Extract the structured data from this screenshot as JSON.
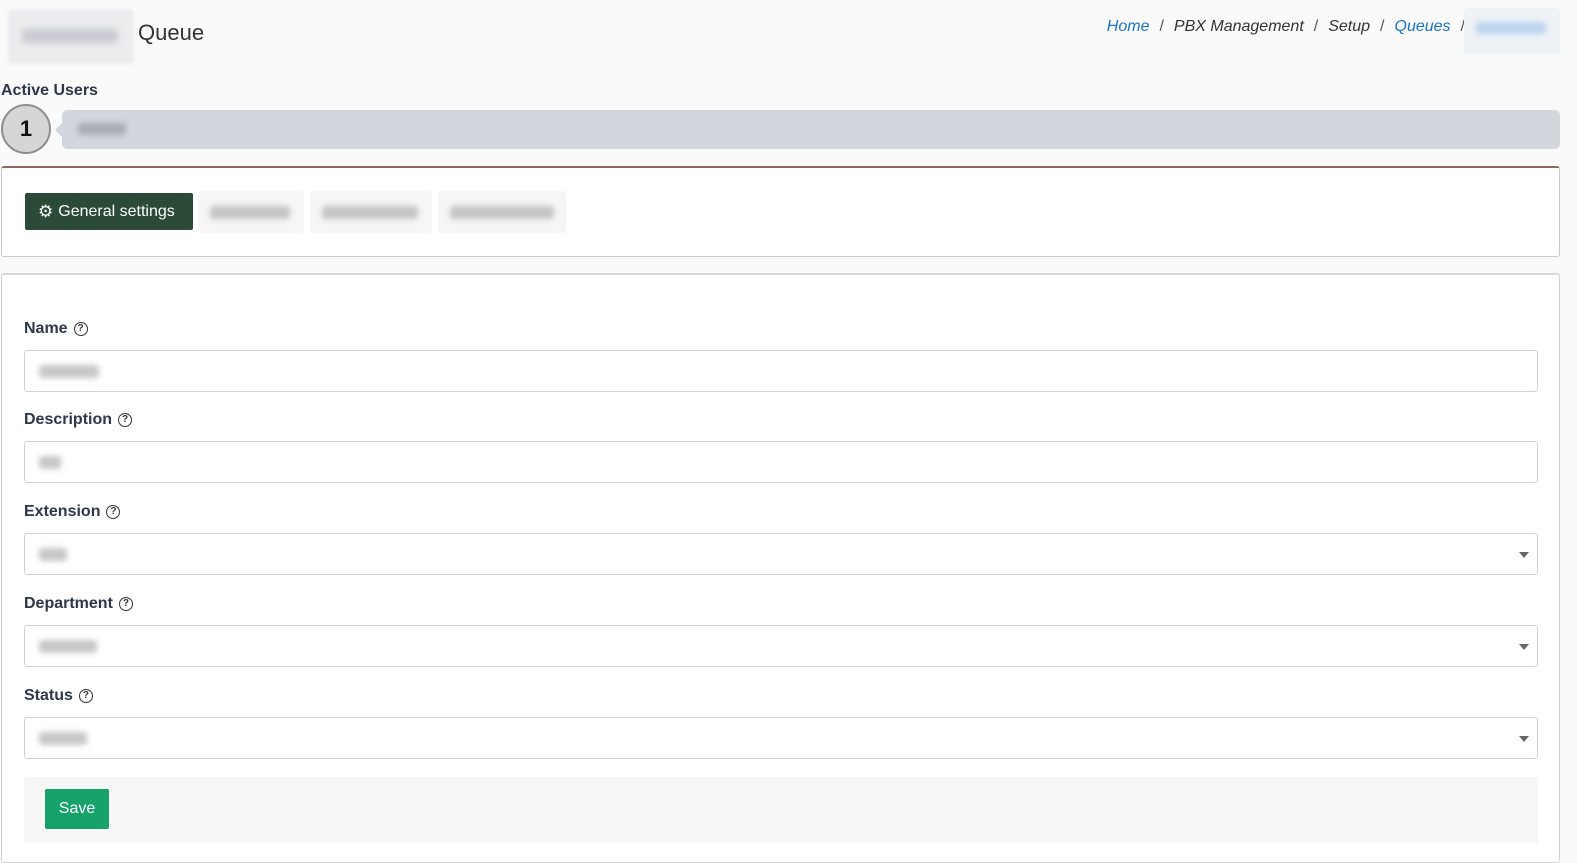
{
  "header": {
    "title": "Queue"
  },
  "breadcrumb": {
    "items": [
      {
        "label": "Home",
        "link": true
      },
      {
        "label": "PBX Management",
        "link": false
      },
      {
        "label": "Setup",
        "link": false
      },
      {
        "label": "Queues",
        "link": true
      }
    ],
    "separator": "/"
  },
  "active_users": {
    "label": "Active Users",
    "count": "1"
  },
  "tabs": {
    "active_label": "General settings"
  },
  "form": {
    "fields": [
      {
        "label": "Name",
        "help": "?"
      },
      {
        "label": "Description",
        "help": "?"
      },
      {
        "label": "Extension",
        "help": "?"
      },
      {
        "label": "Department",
        "help": "?"
      },
      {
        "label": "Status",
        "help": "?"
      }
    ],
    "save_label": "Save"
  },
  "colors": {
    "tab_active_bg": "#2c4a38",
    "save_bg": "#17a26c",
    "link": "#1a73c8",
    "card_top_border": "#8b6a60"
  },
  "icons": {
    "tab_active": "gears-icon",
    "help": "question-circle-icon",
    "dropdown": "caret-down-icon"
  }
}
